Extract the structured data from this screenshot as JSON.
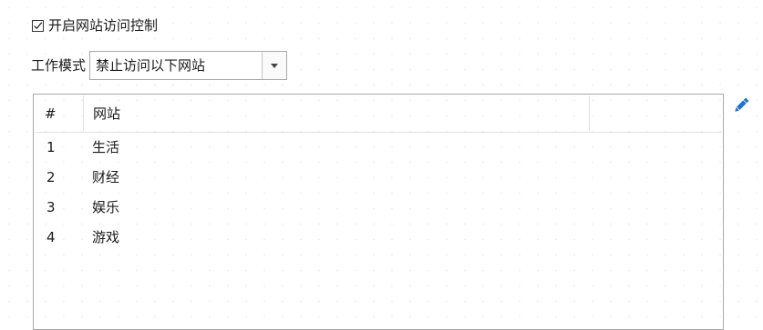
{
  "access_control": {
    "enable_label": "开启网站访问控制",
    "enabled": true
  },
  "work_mode": {
    "label": "工作模式",
    "selected": "禁止访问以下网站"
  },
  "site_list": {
    "columns": {
      "index": "#",
      "site": "网站"
    },
    "rows": [
      {
        "num": "1",
        "site": "生活"
      },
      {
        "num": "2",
        "site": "财经"
      },
      {
        "num": "3",
        "site": "娱乐"
      },
      {
        "num": "4",
        "site": "游戏"
      }
    ]
  },
  "icons": {
    "edit": "pencil-icon",
    "checkbox_mark": "checkmark-icon",
    "dropdown": "chevron-down-icon"
  },
  "colors": {
    "accent": "#1a73d9",
    "border": "#a9a9a9"
  }
}
